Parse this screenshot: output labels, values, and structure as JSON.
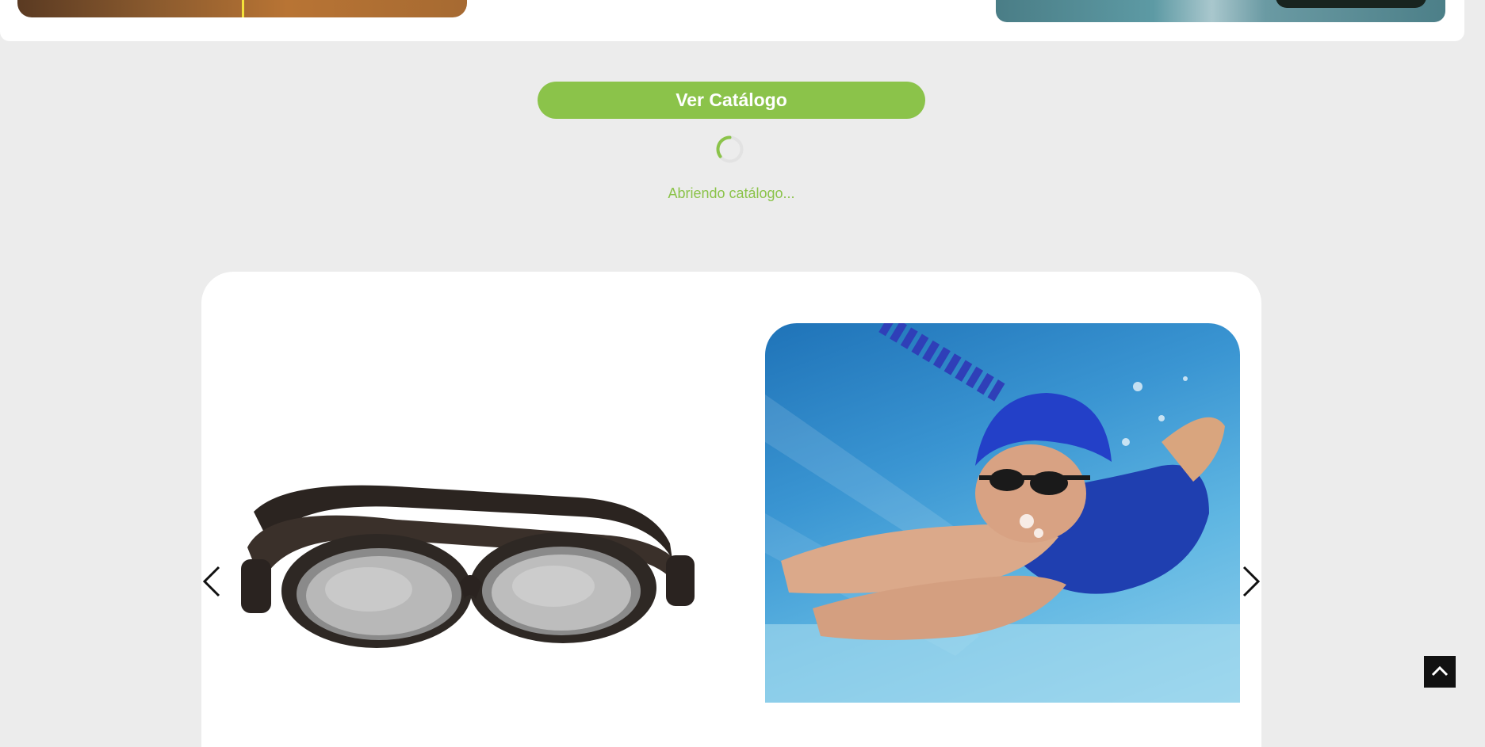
{
  "catalog": {
    "button_label": "Ver Catálogo",
    "loading_text": "Abriendo catálogo..."
  },
  "colors": {
    "accent": "#8bc34a",
    "background": "#ececec",
    "card": "#ffffff"
  },
  "icons": {
    "spinner": "loading-spinner-icon",
    "prev": "chevron-left-icon",
    "next": "chevron-right-icon",
    "back_to_top": "chevron-up-icon"
  }
}
